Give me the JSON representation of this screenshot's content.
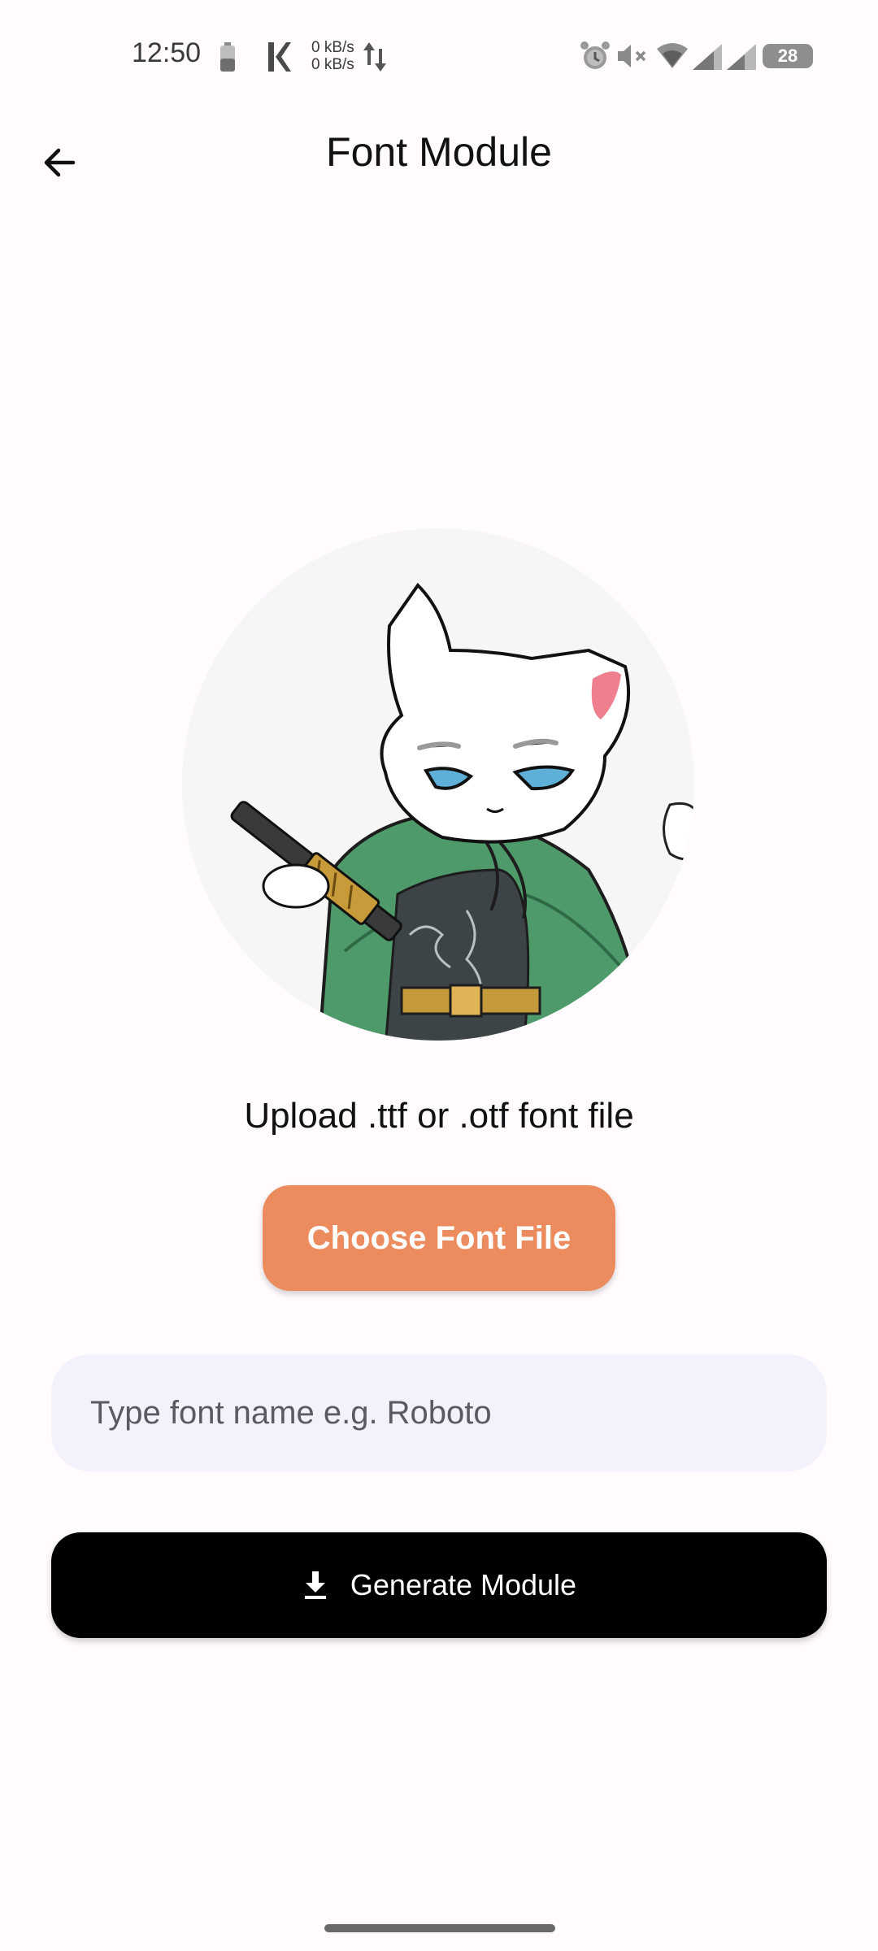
{
  "status_bar": {
    "time": "12:50",
    "net_up": "0 kB/s",
    "net_down": "0 kB/s",
    "battery_level": "28",
    "icons": [
      "battery-saver-icon",
      "k-app-icon",
      "data-arrows-icon",
      "alarm-icon",
      "mute-icon",
      "wifi-icon",
      "signal-icon",
      "signal-icon",
      "battery-icon"
    ]
  },
  "app_bar": {
    "title": "Font Module",
    "back_icon": "arrow-left-icon"
  },
  "illustration": {
    "description_icon": "cat-knight-illustration"
  },
  "upload": {
    "hint": "Upload .ttf or .otf font file",
    "choose_button_label": "Choose Font File"
  },
  "font_name_input": {
    "placeholder": "Type font name e.g. Roboto",
    "value": ""
  },
  "generate": {
    "label": "Generate Module",
    "icon": "download-icon"
  },
  "colors": {
    "background": "#fffbfe",
    "accent": "#ec8c5e",
    "input_fill": "#f4f1fd",
    "primary_button": "#000000"
  }
}
